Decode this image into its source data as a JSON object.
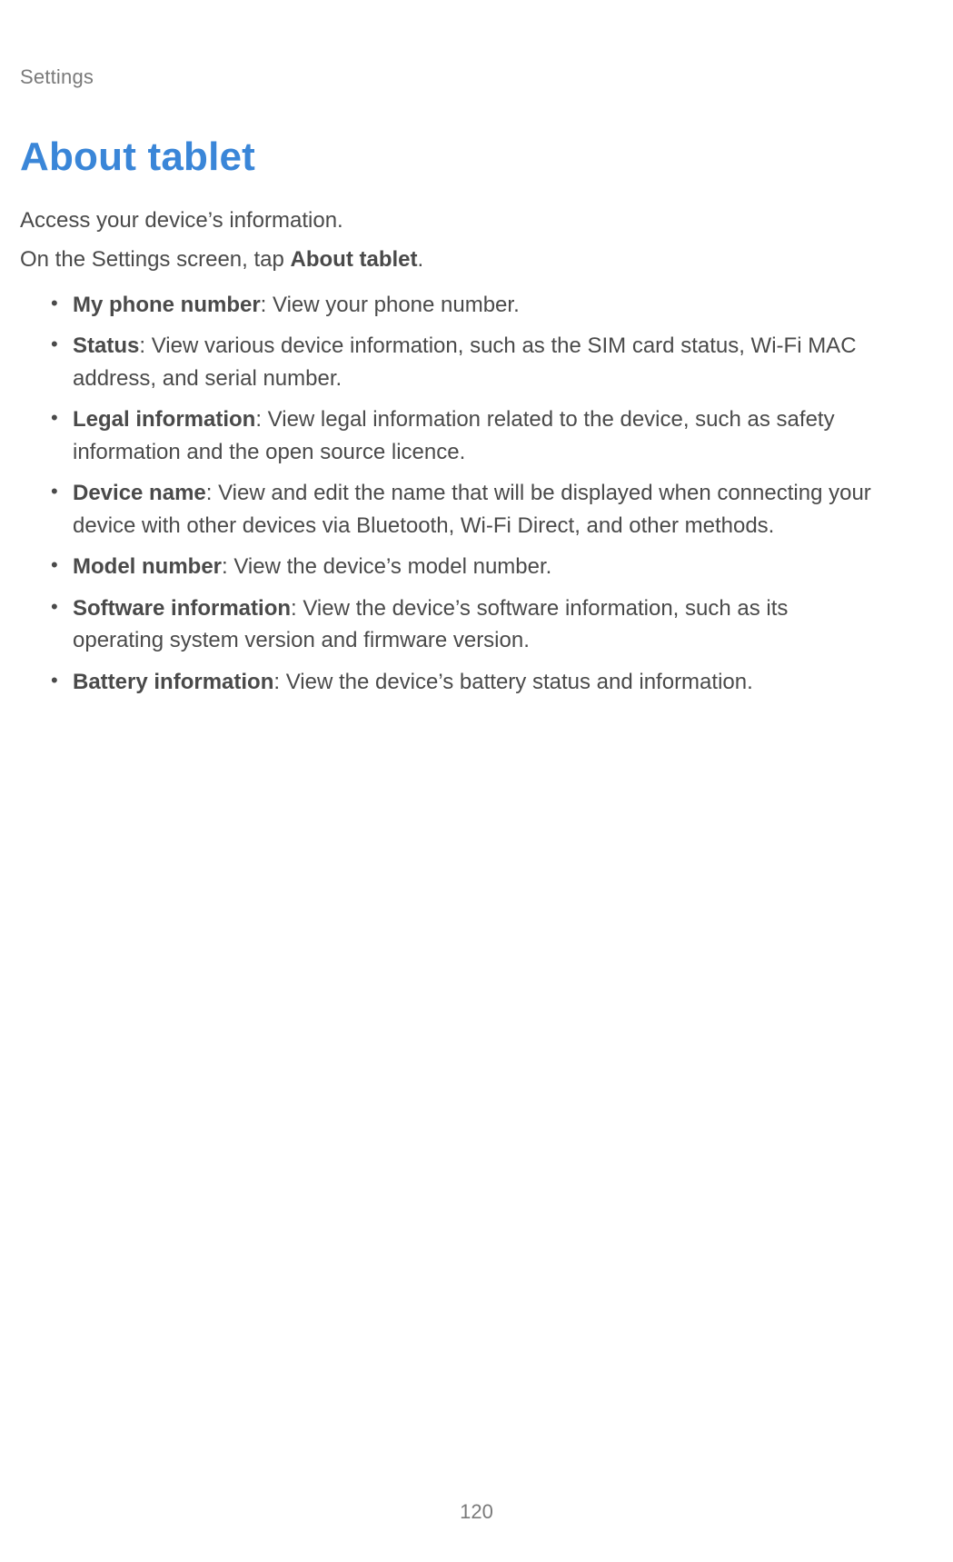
{
  "header": {
    "breadcrumb": "Settings"
  },
  "title": "About tablet",
  "intro": "Access your device’s information.",
  "instruction": {
    "prefix": "On the Settings screen, tap ",
    "bold": "About tablet",
    "suffix": "."
  },
  "items": [
    {
      "term": "My phone number",
      "desc": ": View your phone number."
    },
    {
      "term": "Status",
      "desc": ": View various device information, such as the SIM card status, Wi-Fi MAC address, and serial number."
    },
    {
      "term": "Legal information",
      "desc": ": View legal information related to the device, such as safety information and the open source licence."
    },
    {
      "term": "Device name",
      "desc": ": View and edit the name that will be displayed when connecting your device with other devices via Bluetooth, Wi-Fi Direct, and other methods."
    },
    {
      "term": "Model number",
      "desc": ": View the device’s model number."
    },
    {
      "term": "Software information",
      "desc": ": View the device’s software information, such as its operating system version and firmware version."
    },
    {
      "term": "Battery information",
      "desc": ": View the device’s battery status and information."
    }
  ],
  "page_number": "120"
}
